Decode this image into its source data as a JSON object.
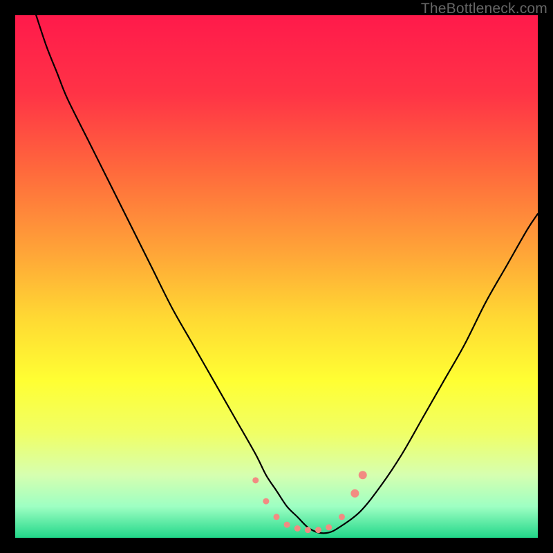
{
  "watermark": "TheBottleneck.com",
  "chart_data": {
    "type": "line",
    "title": "",
    "xlabel": "",
    "ylabel": "",
    "xlim": [
      0,
      100
    ],
    "ylim": [
      0,
      100
    ],
    "background_gradient": {
      "stops": [
        {
          "pos": 0.0,
          "color": "#ff1a4b"
        },
        {
          "pos": 0.15,
          "color": "#ff3346"
        },
        {
          "pos": 0.3,
          "color": "#ff6a3c"
        },
        {
          "pos": 0.45,
          "color": "#ffa338"
        },
        {
          "pos": 0.58,
          "color": "#ffd933"
        },
        {
          "pos": 0.7,
          "color": "#ffff33"
        },
        {
          "pos": 0.8,
          "color": "#f0ff66"
        },
        {
          "pos": 0.88,
          "color": "#d6ffb0"
        },
        {
          "pos": 0.94,
          "color": "#9effc3"
        },
        {
          "pos": 1.0,
          "color": "#21d789"
        }
      ]
    },
    "series": [
      {
        "name": "bottleneck-curve",
        "color": "#000000",
        "x": [
          4,
          6,
          8,
          10,
          14,
          18,
          22,
          26,
          30,
          34,
          38,
          42,
          46,
          48,
          50,
          52,
          54,
          56,
          58,
          60,
          62,
          66,
          70,
          74,
          78,
          82,
          86,
          90,
          94,
          98,
          100
        ],
        "y": [
          100,
          94,
          89,
          84,
          76,
          68,
          60,
          52,
          44,
          37,
          30,
          23,
          16,
          12,
          9,
          6,
          4,
          2,
          1,
          1,
          2,
          5,
          10,
          16,
          23,
          30,
          37,
          45,
          52,
          59,
          62
        ]
      }
    ],
    "markers": {
      "color": "#f28b82",
      "radius_small": 4.5,
      "radius_large": 6,
      "points": [
        {
          "x": 46.0,
          "y": 11.0,
          "r": "small"
        },
        {
          "x": 48.0,
          "y": 7.0,
          "r": "small"
        },
        {
          "x": 50.0,
          "y": 4.0,
          "r": "small"
        },
        {
          "x": 52.0,
          "y": 2.5,
          "r": "small"
        },
        {
          "x": 54.0,
          "y": 1.8,
          "r": "small"
        },
        {
          "x": 56.0,
          "y": 1.5,
          "r": "small"
        },
        {
          "x": 58.0,
          "y": 1.5,
          "r": "small"
        },
        {
          "x": 60.0,
          "y": 2.0,
          "r": "small"
        },
        {
          "x": 62.5,
          "y": 4.0,
          "r": "small"
        },
        {
          "x": 65.0,
          "y": 8.5,
          "r": "large"
        },
        {
          "x": 66.5,
          "y": 12.0,
          "r": "large"
        }
      ]
    }
  }
}
